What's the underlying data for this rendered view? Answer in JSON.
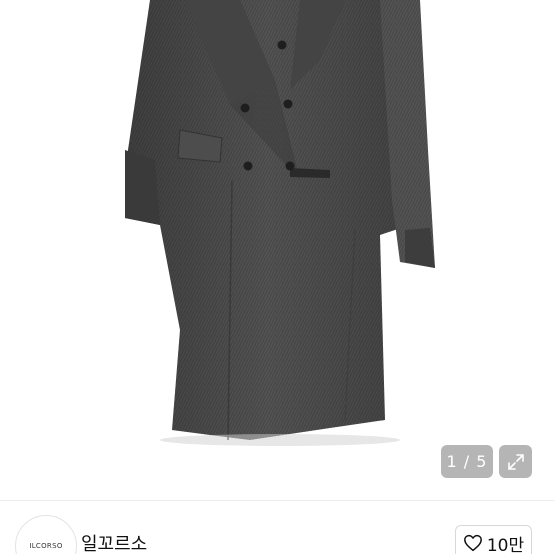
{
  "product_image": {
    "pager": "1 / 5",
    "expand_icon": "expand-arrows-icon"
  },
  "seller": {
    "avatar_text": "ILCORSO",
    "name": "일꼬르소"
  },
  "like": {
    "icon": "heart-outline-icon",
    "count": "10만"
  }
}
